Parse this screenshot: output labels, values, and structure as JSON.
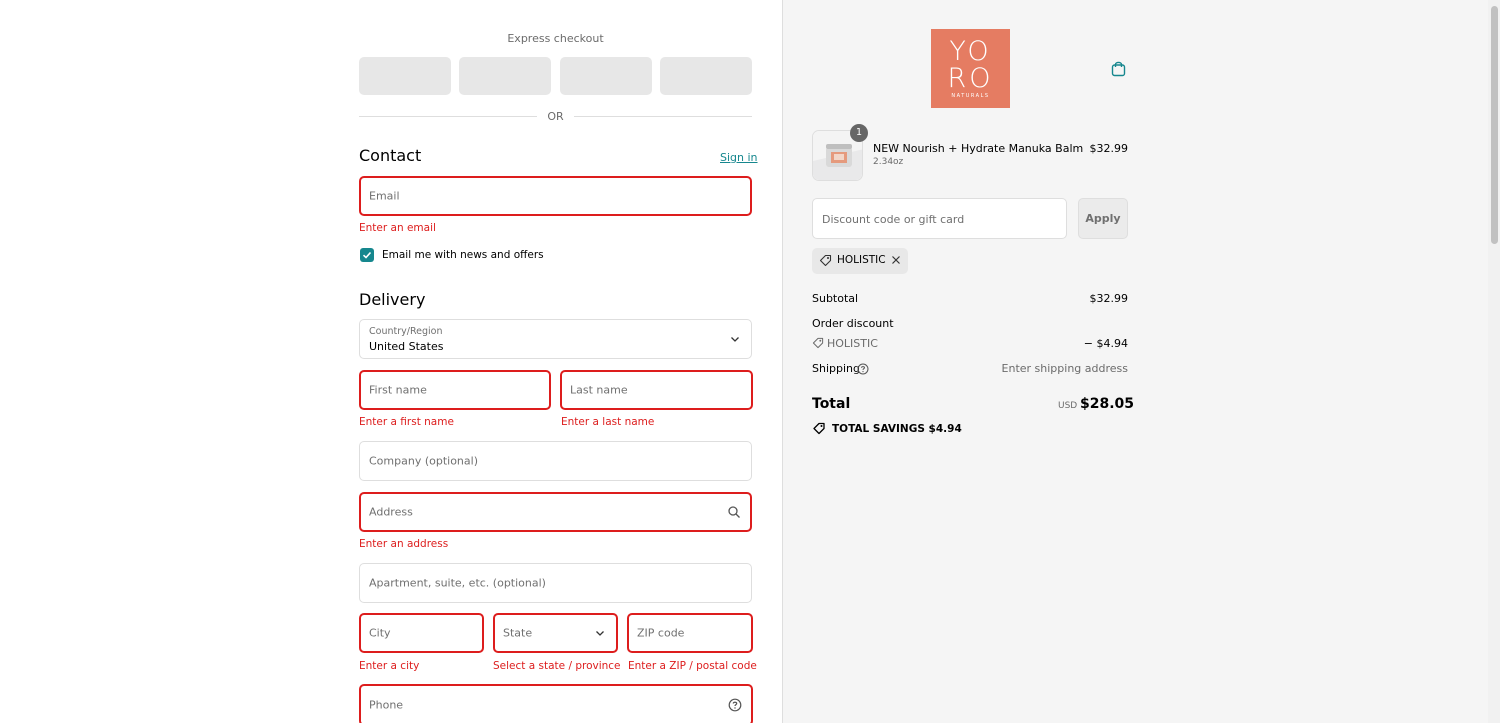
{
  "express": {
    "title": "Express checkout",
    "or_label": "OR"
  },
  "contact": {
    "heading": "Contact",
    "sign_in": "Sign in",
    "email_placeholder": "Email",
    "email_error": "Enter an email",
    "newsletter_label": "Email me with news and offers",
    "newsletter_checked": true
  },
  "delivery": {
    "heading": "Delivery",
    "country_label": "Country/Region",
    "country_value": "United States",
    "first_name_placeholder": "First name",
    "first_name_error": "Enter a first name",
    "last_name_placeholder": "Last name",
    "last_name_error": "Enter a last name",
    "company_placeholder": "Company (optional)",
    "address_placeholder": "Address",
    "address_error": "Enter an address",
    "apartment_placeholder": "Apartment, suite, etc. (optional)",
    "city_placeholder": "City",
    "city_error": "Enter a city",
    "state_placeholder": "State",
    "state_error": "Select a state / province",
    "zip_placeholder": "ZIP code",
    "zip_error": "Enter a ZIP / postal code",
    "phone_placeholder": "Phone"
  },
  "brand": {
    "logo_line1": "YO",
    "logo_line2": "RO",
    "logo_line3": "NATURALS",
    "logo_color": "#e57c62"
  },
  "order": {
    "item": {
      "name": "NEW Nourish + Hydrate Manuka Balm",
      "variant": "2.34oz",
      "price": "$32.99",
      "quantity": "1"
    },
    "discount_placeholder": "Discount code or gift card",
    "apply_label": "Apply",
    "applied_code": "HOLISTIC",
    "subtotal_label": "Subtotal",
    "subtotal_value": "$32.99",
    "order_discount_label": "Order discount",
    "discount_code": "HOLISTIC",
    "discount_value": "− $4.94",
    "shipping_label": "Shipping",
    "shipping_value": "Enter shipping address",
    "total_label": "Total",
    "total_currency": "USD",
    "total_value": "$28.05",
    "savings_label": "TOTAL SAVINGS",
    "savings_value": "$4.94"
  },
  "colors": {
    "accent": "#16878e",
    "error": "#dd1d1d",
    "sidebar_bg": "#f5f5f5"
  }
}
